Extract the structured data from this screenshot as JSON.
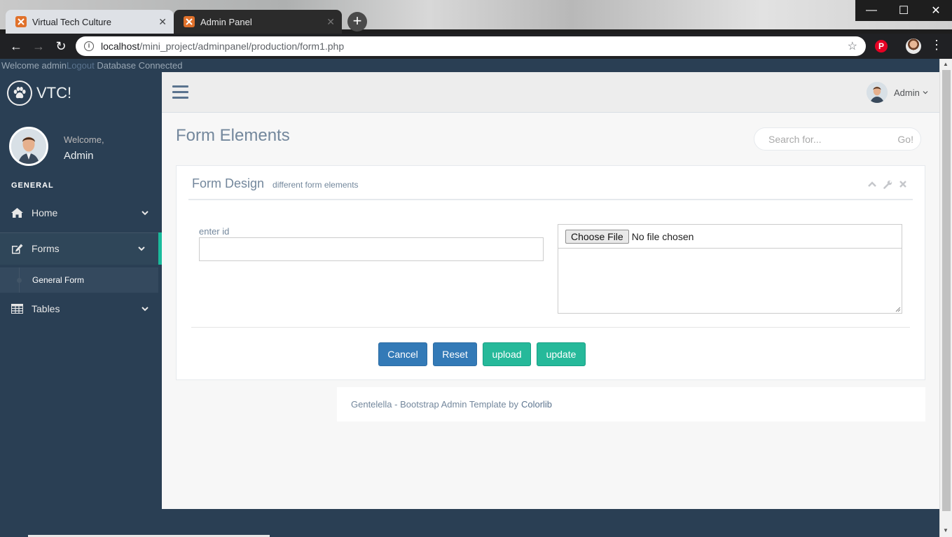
{
  "browser": {
    "tabs": [
      {
        "label": "Virtual Tech Culture",
        "active": true
      },
      {
        "label": "Admin Panel",
        "active": false
      }
    ],
    "url_host": "localhost",
    "url_path": "/mini_project/adminpanel/production/form1.php"
  },
  "status_line": {
    "welcome": "Welcome admin",
    "logout": "Logout",
    "db": " Database Connected"
  },
  "sidebar": {
    "brand": "VTC!",
    "welcome": "Welcome,",
    "user": "Admin",
    "section": "GENERAL",
    "items": [
      {
        "label": "Home",
        "icon": "home-icon"
      },
      {
        "label": "Forms",
        "icon": "edit-icon"
      },
      {
        "label": "Tables",
        "icon": "table-icon"
      }
    ],
    "submenu_item": "General Form"
  },
  "topnav": {
    "user": "Admin"
  },
  "content": {
    "title": "Form Elements",
    "search_placeholder": "Search for...",
    "search_go": "Go!"
  },
  "panel": {
    "title": "Form Design",
    "subtitle": "different form elements",
    "id_label": "enter id",
    "file_button": "Choose File",
    "file_status": "No file chosen",
    "buttons": {
      "cancel": "Cancel",
      "reset": "Reset",
      "upload": "upload",
      "update": "update"
    }
  },
  "footer": {
    "text": "Gentelella - Bootstrap Admin Template by",
    "link": "Colorlib"
  },
  "colors": {
    "sidebar_bg": "#2A3F54",
    "accent_green": "#1ABB9C",
    "primary_blue": "#337ab7",
    "success_green": "#26B99A",
    "text_muted": "#73879C"
  }
}
